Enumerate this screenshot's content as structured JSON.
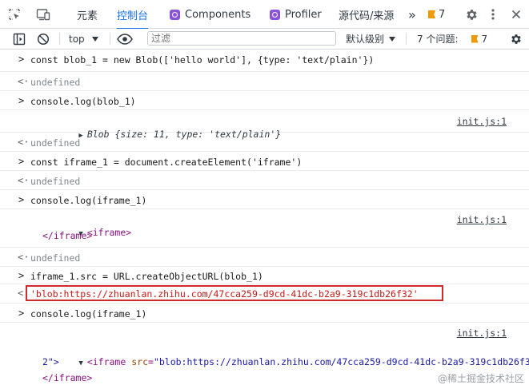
{
  "tabs": {
    "inspect_icon": "inspect-element-icon",
    "device_icon": "device-toolbar-icon",
    "elements": "元素",
    "console": "控制台",
    "components": "Components",
    "profiler": "Profiler",
    "sources": "源代码/来源",
    "more": "»",
    "issue_count": "7",
    "colors": {
      "active": "#1a73e8",
      "react": "#8a54d8",
      "warning": "#f29900"
    }
  },
  "toolbar": {
    "context": "top",
    "filter_placeholder": "过滤",
    "level": "默认级别",
    "issues_label": "7 个问题:",
    "issues_count": "7"
  },
  "console": {
    "rows": [
      {
        "kind": "input",
        "text": "const blob_1 = new Blob(['hello world'], {type: 'text/plain'})"
      },
      {
        "kind": "result",
        "text": "undefined"
      },
      {
        "kind": "input",
        "text": "console.log(blob_1)"
      },
      {
        "kind": "log",
        "prefix": "Blob",
        "text": "{size: 11, type: 'text/plain'}",
        "source": "init.js:1"
      },
      {
        "kind": "result",
        "text": "undefined"
      },
      {
        "kind": "input",
        "text": "const iframe_1 = document.createElement('iframe')"
      },
      {
        "kind": "result",
        "text": "undefined"
      },
      {
        "kind": "input",
        "text": "console.log(iframe_1)"
      },
      {
        "kind": "log",
        "open_tag": "<iframe>",
        "close_tag": "</iframe>",
        "source": "init.js:1"
      },
      {
        "kind": "result",
        "text": "undefined"
      },
      {
        "kind": "input",
        "text": "iframe_1.src = URL.createObjectURL(blob_1)"
      },
      {
        "kind": "result",
        "text": "'blob:https://zhuanlan.zhihu.com/47cca259-d9cd-41dc-b2a9-319c1db26f32'"
      },
      {
        "kind": "input",
        "text": "console.log(iframe_1)"
      },
      {
        "kind": "log",
        "source": "init.js:1",
        "tag_open": "<iframe",
        "attr_name": "src",
        "attr_value_line1": "\"blob:https://zhuanlan.zhihu.com/47cca259-d9cd-41dc-b2a9-319c1db26f3",
        "attr_value_line2": "2\">",
        "close_tag": "</iframe>"
      }
    ]
  },
  "watermark": "@稀土掘金技术社区"
}
